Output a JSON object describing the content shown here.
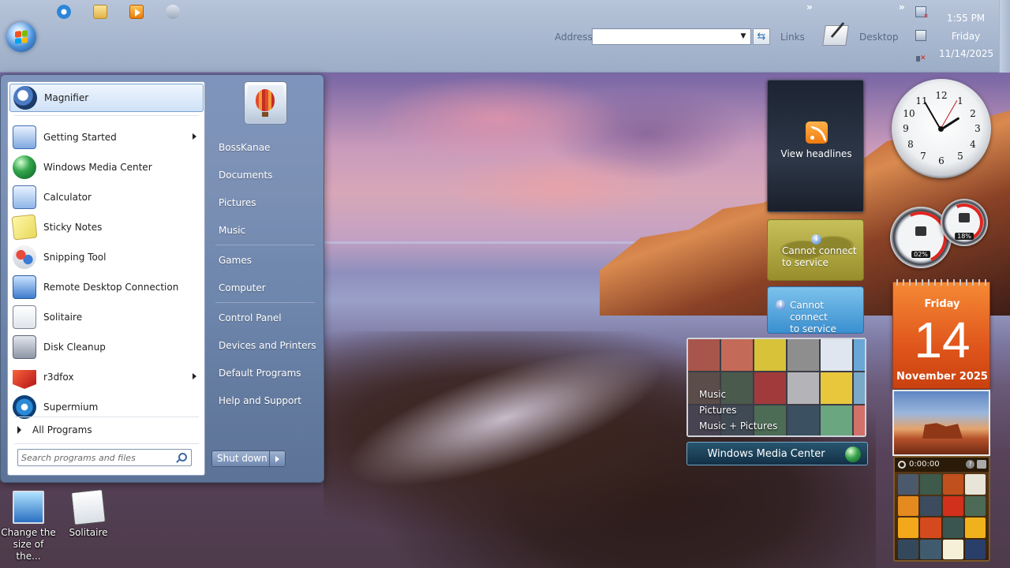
{
  "taskbar": {
    "quick_launch": [
      {
        "name": "internet-explorer-icon"
      },
      {
        "name": "windows-explorer-icon"
      },
      {
        "name": "windows-media-player-icon"
      },
      {
        "name": "gimp-icon"
      }
    ],
    "address": {
      "label": "Address",
      "value": "",
      "placeholder": ""
    },
    "links_label": "Links",
    "desktop_label": "Desktop",
    "chevron": "»",
    "clock": {
      "time": "1:55 PM",
      "day": "Friday",
      "date": "11/14/2025"
    }
  },
  "start_menu": {
    "programs": [
      {
        "label": "Magnifier",
        "icon": "magnifier-icon",
        "submenu": false,
        "highlighted": true
      },
      {
        "label": "Getting Started",
        "icon": "getting-started-icon",
        "submenu": true
      },
      {
        "label": "Windows Media Center",
        "icon": "windows-media-center-icon",
        "submenu": false
      },
      {
        "label": "Calculator",
        "icon": "calculator-icon",
        "submenu": false
      },
      {
        "label": "Sticky Notes",
        "icon": "sticky-notes-icon",
        "submenu": false
      },
      {
        "label": "Snipping Tool",
        "icon": "snipping-tool-icon",
        "submenu": false
      },
      {
        "label": "Remote Desktop Connection",
        "icon": "remote-desktop-icon",
        "submenu": false
      },
      {
        "label": "Solitaire",
        "icon": "solitaire-icon",
        "submenu": false
      },
      {
        "label": "Disk Cleanup",
        "icon": "disk-cleanup-icon",
        "submenu": false
      },
      {
        "label": "r3dfox",
        "icon": "r3dfox-icon",
        "submenu": true
      },
      {
        "label": "Supermium",
        "icon": "supermium-icon",
        "submenu": false
      }
    ],
    "all_programs": "All Programs",
    "search_placeholder": "Search programs and files",
    "places": [
      "BossKanae",
      "Documents",
      "Pictures",
      "Music",
      "Games",
      "Computer",
      "Control Panel",
      "Devices and Printers",
      "Default Programs",
      "Help and Support"
    ],
    "shutdown": "Shut down"
  },
  "desktop_icons": [
    {
      "label": "Change the size of the...",
      "icon": "display-settings-icon"
    },
    {
      "label": "Solitaire",
      "icon": "solitaire-shortcut-icon"
    }
  ],
  "gadgets": {
    "feed": {
      "label": "View headlines"
    },
    "weather1": {
      "line1": "Cannot connect",
      "line2": "to service"
    },
    "weather2": {
      "line1": "Cannot connect",
      "line2": "to service"
    },
    "media_center": {
      "menu": [
        "Music",
        "Pictures",
        "Music + Pictures"
      ],
      "bar_label": "Windows Media Center"
    },
    "clock": {
      "numbers": [
        "12",
        "1",
        "2",
        "3",
        "4",
        "5",
        "6",
        "7",
        "8",
        "9",
        "10",
        "11"
      ],
      "hour": 1,
      "minute": 55,
      "second": 5
    },
    "meter": {
      "cpu": "02%",
      "memory": "18%"
    },
    "calendar": {
      "weekday": "Friday",
      "day": "14",
      "month": "November 2025"
    },
    "puzzle": {
      "timer": "0:00:00",
      "help": "?"
    }
  },
  "colors": {
    "accent": "#e0561c",
    "taskbar": "#9cadc7"
  }
}
